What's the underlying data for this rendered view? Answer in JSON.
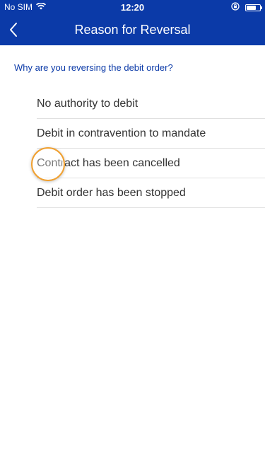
{
  "status_bar": {
    "carrier": "No SIM",
    "time": "12:20",
    "battery_level": 0.7
  },
  "header": {
    "title": "Reason for Reversal",
    "back_icon": "chevron-left-icon",
    "background_color": "#0b3aa8"
  },
  "question": "Why are you reversing the debit order?",
  "options": [
    {
      "label": "No authority to debit"
    },
    {
      "label": "Debit in contravention to mandate"
    },
    {
      "label": "Contract has been cancelled"
    },
    {
      "label": "Debit order has been stopped"
    }
  ],
  "accent_color": "#0b3aa8",
  "tap_indicator_color": "#f0a030"
}
